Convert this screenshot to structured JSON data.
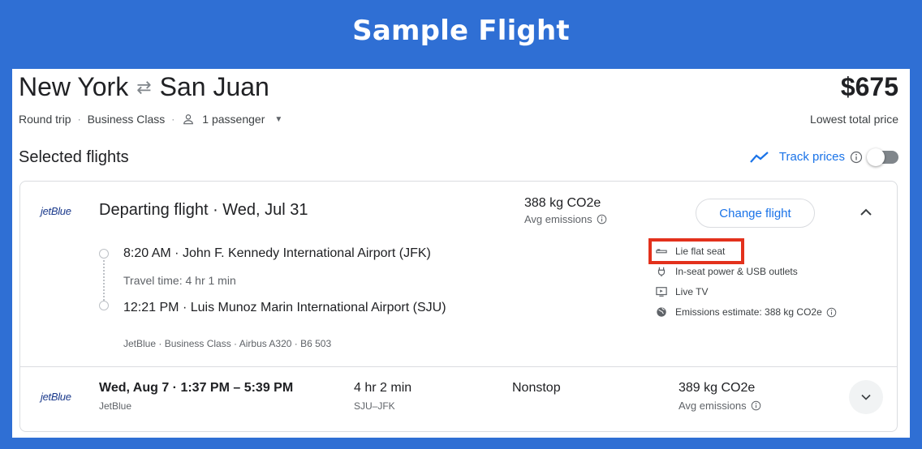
{
  "banner": {
    "title": "Sample Flight"
  },
  "trip": {
    "origin": "New York",
    "destination": "San Juan",
    "trip_type": "Round trip",
    "cabin": "Business Class",
    "passengers": "1 passenger",
    "price": "$675",
    "price_note": "Lowest total price"
  },
  "selected": {
    "heading": "Selected flights",
    "track_label": "Track prices"
  },
  "departing": {
    "airline_logo": "jetBlue",
    "heading": "Departing flight · Wed, Jul 31",
    "emissions": "388 kg CO2e",
    "emissions_label": "Avg emissions",
    "change_label": "Change flight",
    "dep_time": "8:20 AM",
    "dep_airport": "John F. Kennedy International Airport (JFK)",
    "travel_time": "Travel time: 4 hr 1 min",
    "arr_time": "12:21 PM",
    "arr_airport": "Luis Munoz Marin International Airport (SJU)",
    "details": "JetBlue · Business Class · Airbus A320 · B6 503",
    "amenities": [
      {
        "icon": "lie-flat-seat-icon",
        "label": "Lie flat seat"
      },
      {
        "icon": "power-plug-icon",
        "label": "In-seat power & USB outlets"
      },
      {
        "icon": "live-tv-icon",
        "label": "Live TV"
      },
      {
        "icon": "globe-icon",
        "label": "Emissions estimate: 388 kg CO2e"
      }
    ],
    "highlight_color": "#e3311c"
  },
  "returning": {
    "airline_logo": "jetBlue",
    "date_time": "Wed, Aug 7 · 1:37 PM – 5:39 PM",
    "airline": "JetBlue",
    "duration": "4 hr 2 min",
    "route": "SJU–JFK",
    "stops": "Nonstop",
    "emissions": "389 kg CO2e",
    "emissions_label": "Avg emissions"
  },
  "colors": {
    "background": "#2f6fd4",
    "accent": "#1a73e8",
    "highlight": "#e3311c"
  }
}
